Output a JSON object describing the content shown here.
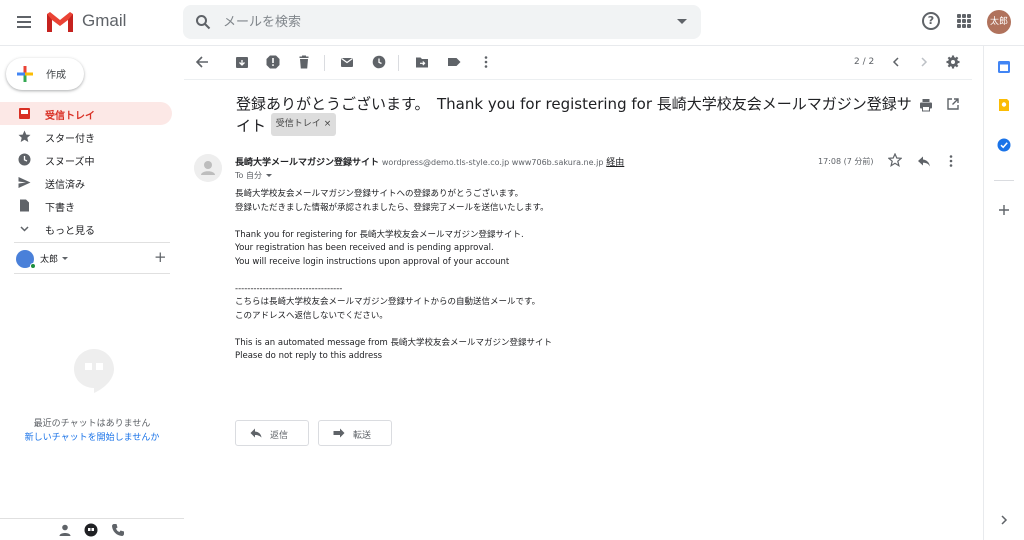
{
  "header": {
    "app_name": "Gmail",
    "search_placeholder": "メールを検索",
    "avatar_text": "太郎",
    "help_glyph": "?"
  },
  "sidebar": {
    "compose_label": "作成",
    "items": [
      {
        "label": "受信トレイ",
        "icon": "inbox-icon",
        "active": true
      },
      {
        "label": "スター付き",
        "icon": "star-icon"
      },
      {
        "label": "スヌーズ中",
        "icon": "clock-icon"
      },
      {
        "label": "送信済み",
        "icon": "send-icon"
      },
      {
        "label": "下書き",
        "icon": "draft-icon"
      },
      {
        "label": "もっと見る",
        "icon": "chevron-down-icon"
      }
    ],
    "user_name": "太郎",
    "add_glyph": "+",
    "chat_none": "最近のチャットはありません",
    "chat_start": "新しいチャットを開始しませんか"
  },
  "toolbar": {
    "counter": "2 / 2"
  },
  "email": {
    "subject": "登録ありがとうございます。　Thank you for registering for 長崎大学校友会メールマガジン登録サイト",
    "label_badge": "受信トレイ",
    "badge_close": "×",
    "sender_name": "長崎大学メールマガジン登録サイト",
    "sender_addr": "wordpress@demo.tls-style.co.jp www706b.sakura.ne.jp",
    "via": "経由",
    "to": "To 自分",
    "time": "17:08 (7 分前)",
    "body": [
      "長崎大学校友会メールマガジン登録サイトへの登録ありがとうございます。",
      "登録いただきました情報が承認されましたら、登録完了メールを送信いたします。",
      "",
      "Thank you for registering for 長崎大学校友会メールマガジン登録サイト.",
      "Your registration has been received and is pending approval.",
      "You will receive login instructions upon approval of your account",
      "",
      "-----------------------------------",
      "こちらは長崎大学校友会メールマガジン登録サイトからの自動送信メールです。",
      "このアドレスへ返信しないでください。",
      "",
      "This is an automated message from 長崎大学校友会メールマガジン登録サイト",
      "Please do not reply to this address"
    ],
    "reply_label": "返信",
    "forward_label": "転送"
  },
  "colors": {
    "accent_red": "#d93025",
    "active_bg": "#fce8e6",
    "link_blue": "#1a73e8"
  }
}
